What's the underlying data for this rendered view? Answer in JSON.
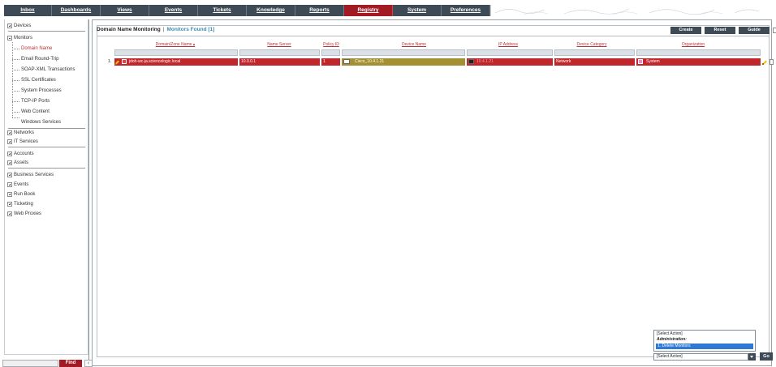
{
  "nav": {
    "tabs": [
      {
        "label": "Inbox",
        "active": false
      },
      {
        "label": "Dashboards",
        "active": false
      },
      {
        "label": "Views",
        "active": false
      },
      {
        "label": "Events",
        "active": false
      },
      {
        "label": "Tickets",
        "active": false
      },
      {
        "label": "Knowledge",
        "active": false
      },
      {
        "label": "Reports",
        "active": false
      },
      {
        "label": "Registry",
        "active": true
      },
      {
        "label": "System",
        "active": false
      },
      {
        "label": "Preferences",
        "active": false
      }
    ]
  },
  "sidebar": {
    "devices": "Devices",
    "monitors": "Monitors",
    "monitor_items": [
      "Domain Name",
      "Email Round-Trip",
      "SOAP-XML Transactions",
      "SSL Certificates",
      "System Processes",
      "TCP-IP Ports",
      "Web Content",
      "Windows Services"
    ],
    "items_after": [
      "Networks",
      "IT Services",
      "Accounts",
      "Assets",
      "Business Services",
      "Events",
      "Run Book",
      "Ticketing",
      "Web Proxies"
    ],
    "find_label": "Find"
  },
  "main": {
    "title": "Domain Name Monitoring",
    "found": "Monitors Found [1]",
    "buttons": {
      "create": "Create",
      "reset": "Reset",
      "guide": "Guide"
    },
    "columns": [
      "Domain/Zone Name ▴",
      "Name Server",
      "Policy ID",
      "Device Name",
      "IP Address",
      "Device Category",
      "Organization"
    ],
    "row": {
      "num": "1.",
      "domain": "jdoh-wc-ja.sciencelogic.local",
      "name_server": "10.0.0.1",
      "policy_id": "1",
      "device": "Cisco_10.4.1.21",
      "ip": "10.4.1.21",
      "category": "Network",
      "organization": "System"
    },
    "actions": {
      "select_placeholder": "[Select Action]",
      "group": "Administration:",
      "item": "1. Delete Monitors",
      "select_value": "[Select Action]",
      "go": "Go"
    }
  },
  "colors": {
    "nav_bg": "#3e4a56",
    "active_tab": "#a21b24",
    "row_red": "#c0272d",
    "row_olive": "#a39033",
    "link_red": "#b5343a",
    "found_blue": "#3c8cb1"
  }
}
